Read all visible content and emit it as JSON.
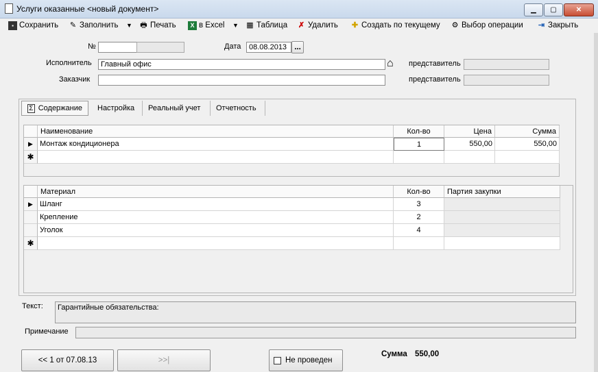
{
  "window": {
    "title": "Услуги оказанные <новый документ>"
  },
  "toolbar": {
    "save": "Сохранить",
    "fill": "Заполнить",
    "print": "Печать",
    "excel": "в Excel",
    "table": "Таблица",
    "delete": "Удалить",
    "create_current": "Создать по текущему",
    "choose_op": "Выбор операции",
    "close": "Закрыть"
  },
  "header": {
    "number_label": "№",
    "number_value": "",
    "date_label": "Дата",
    "date_value": "08.08.2013",
    "date_btn": "...",
    "executor_label": "Исполнитель",
    "executor_value": "Главный офис",
    "customer_label": "Заказчик",
    "customer_value": "",
    "rep_label_1": "представитель",
    "rep_label_2": "представитель"
  },
  "tabs": [
    {
      "label": "Содержание",
      "active": true
    },
    {
      "label": "Настройка"
    },
    {
      "label": "Реальный учет"
    },
    {
      "label": "Отчетность"
    }
  ],
  "services_grid": {
    "columns": [
      "Наименование",
      "Кол-во",
      "Цена",
      "Сумма"
    ],
    "rows": [
      {
        "name": "Монтаж кондиционера",
        "qty": "1",
        "price": "550,00",
        "sum": "550,00"
      }
    ]
  },
  "materials_grid": {
    "columns": [
      "Материал",
      "Кол-во",
      "Партия закупки"
    ],
    "rows": [
      {
        "name": "Шланг",
        "qty": "3",
        "batch": ""
      },
      {
        "name": "Крепление",
        "qty": "2",
        "batch": ""
      },
      {
        "name": "Уголок",
        "qty": "4",
        "batch": ""
      }
    ]
  },
  "text_section": {
    "label": "Текст:",
    "value": "Гарантийные обязательства:"
  },
  "note_section": {
    "label": "Примечание",
    "value": ""
  },
  "footer": {
    "prev_btn": "<< 1 от 07.08.13",
    "next_btn": ">>|",
    "status_label": "Не проведен",
    "sum_label": "Сумма",
    "sum_value": "550,00"
  }
}
